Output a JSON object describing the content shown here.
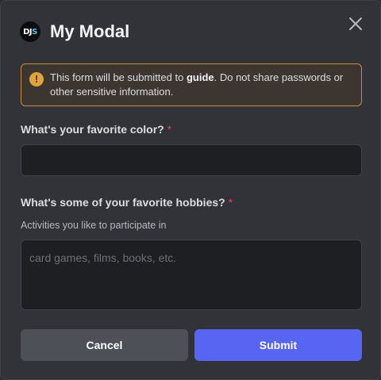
{
  "modal": {
    "title": "My Modal",
    "logo_text_left": "DJ",
    "logo_text_right": "S"
  },
  "warning": {
    "text_before": "This form will be submitted to ",
    "target": "guide",
    "text_after": ". Do not share passwords or other sensitive information.",
    "icon": "exclamation-icon"
  },
  "fields": [
    {
      "label": "What's your favorite color?",
      "required_mark": "*",
      "value": "",
      "placeholder": ""
    },
    {
      "label": "What's some of your favorite hobbies?",
      "required_mark": "*",
      "hint": "Activities you like to participate in",
      "value": "",
      "placeholder": "card games, films, books, etc."
    }
  ],
  "buttons": {
    "cancel": "Cancel",
    "submit": "Submit"
  },
  "colors": {
    "background": "#313338",
    "accent": "#5865f2",
    "warning_border": "#c98a3c",
    "required": "#f23f43"
  }
}
